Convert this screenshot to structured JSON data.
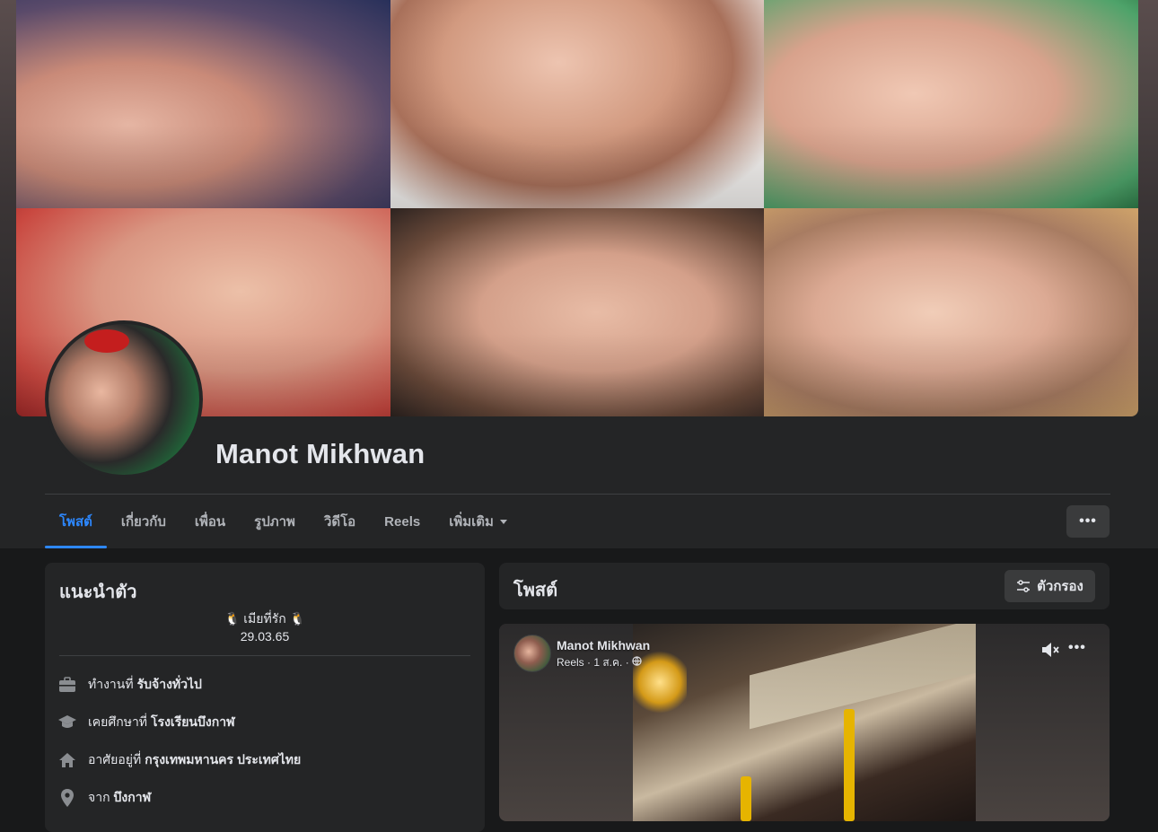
{
  "profile": {
    "name": "Manot Mikhwan"
  },
  "tabs": [
    {
      "label": "โพสต์",
      "active": true
    },
    {
      "label": "เกี่ยวกับ"
    },
    {
      "label": "เพื่อน"
    },
    {
      "label": "รูปภาพ"
    },
    {
      "label": "วิดีโอ"
    },
    {
      "label": "Reels"
    },
    {
      "label": "เพิ่มเติม"
    }
  ],
  "more_button": "•••",
  "intro": {
    "title": "แนะนำตัว",
    "bio_line1": "🐧 เมียที่รัก 🐧",
    "bio_line2": "29.03.65",
    "work_prefix": "ทำงานที่",
    "work_value": "รับจ้างทั่วไป",
    "study_prefix": "เคยศึกษาที่",
    "study_value": "โรงเรียนบึงกาฬ",
    "lives_prefix": "อาศัยอยู่ที่",
    "lives_value": "กรุงเทพมหานคร ประเทศไทย",
    "from_prefix": "จาก",
    "from_value": "บึงกาฬ"
  },
  "posts": {
    "title": "โพสต์",
    "filter_label": "ตัวกรอง"
  },
  "post": {
    "author": "Manot Mikhwan",
    "meta": "Reels · 1 ส.ค. ·",
    "more": "•••"
  },
  "colors": {
    "accent": "#2d88ff",
    "card": "#242526",
    "page_bg": "#18191a"
  }
}
